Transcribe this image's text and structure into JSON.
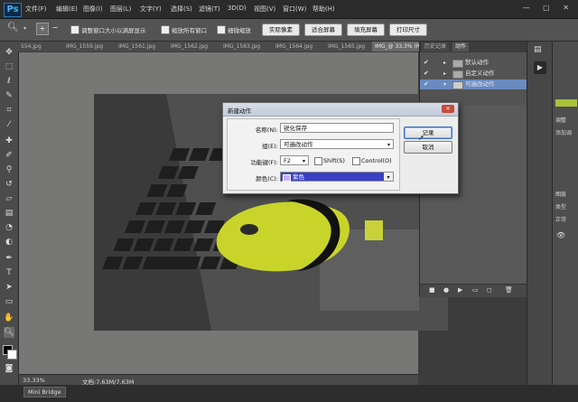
{
  "app": {
    "logo": "Ps",
    "menu": [
      "文件(F)",
      "编辑(E)",
      "图像(I)",
      "图层(L)",
      "文字(Y)",
      "选择(S)",
      "滤镜(T)",
      "3D(D)",
      "视图(V)",
      "窗口(W)",
      "帮助(H)"
    ],
    "window_controls": "— ▢ ✕"
  },
  "options": {
    "fit_window_label": "调整窗口大小以满屏显示",
    "zoom_all_label": "缩放所有窗口",
    "scrubby_zoom_label": "细微缩放",
    "actual_pixels": "实际像素",
    "fit_screen": "适合屏幕",
    "fill_screen": "填充屏幕",
    "print_size": "打印尺寸"
  },
  "tabs": [
    "554.jpg",
    "IMG_1559.jpg",
    "IMG_1561.jpg",
    "IMG_1562.jpg",
    "IMG_1563.jpg",
    "IMG_1564.jpg",
    "IMG_1565.jpg",
    "IMG_@ 33.3% (RGB/8)"
  ],
  "status": {
    "zoom": "33.33%",
    "doc": "文档:7.63M/7.63M"
  },
  "bottom": {
    "minibridge": "Mini Bridge"
  },
  "actions_panel": {
    "tabs": [
      "历史记录",
      "动作"
    ],
    "items": [
      "默认动作",
      "自定义动作",
      "可遍改动作"
    ],
    "selected_index": 2
  },
  "dock": {
    "mid": [
      "调整",
      "添加调"
    ],
    "right": [
      "图层",
      "类型",
      "正常"
    ]
  },
  "dialog": {
    "title": "新建动作",
    "name_label": "名称(N):",
    "name_value": "锐化保存",
    "set_label": "组(E):",
    "set_value": "可遍改动作",
    "fkey_label": "功能键(F):",
    "fkey_value": "F2",
    "shift_label": "Shift(S)",
    "control_label": "Control(O)",
    "color_label": "颜色(C):",
    "color_value": "紫色",
    "record_button": "记录",
    "cancel_button": "取消",
    "close": "✕"
  }
}
